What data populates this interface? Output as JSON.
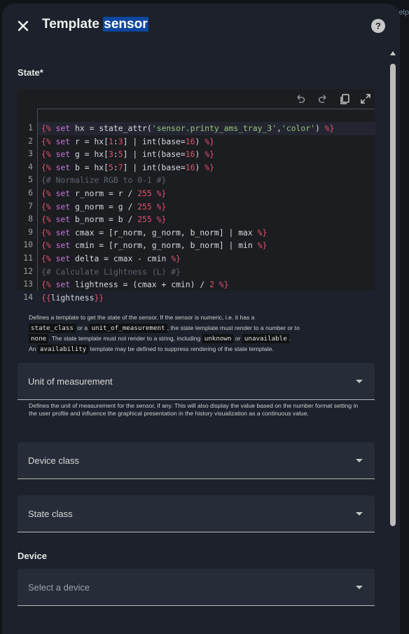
{
  "background": {
    "help_text": "elp"
  },
  "dialog": {
    "title_prefix": "Template ",
    "title_selected": "sensor"
  },
  "state": {
    "label": "State*",
    "editor": {
      "lines": [
        [
          [
            "tag",
            "{%"
          ],
          [
            "kw",
            " set "
          ],
          [
            "name",
            "hx"
          ],
          [
            "op",
            " = "
          ],
          [
            "name",
            "state_attr("
          ],
          [
            "str",
            "'sensor.printy_ams_tray_3'"
          ],
          [
            "op",
            ","
          ],
          [
            "str",
            "'color'"
          ],
          [
            "name",
            ")"
          ],
          [
            "tag",
            " %}"
          ]
        ],
        [
          [
            "tag",
            "{%"
          ],
          [
            "kw",
            " set "
          ],
          [
            "name",
            "r"
          ],
          [
            "op",
            " = "
          ],
          [
            "name",
            "hx["
          ],
          [
            "num",
            "1"
          ],
          [
            "op",
            ":"
          ],
          [
            "num",
            "3"
          ],
          [
            "name",
            "]"
          ],
          [
            "op",
            " | "
          ],
          [
            "name",
            "int(base="
          ],
          [
            "num",
            "16"
          ],
          [
            "name",
            ")"
          ],
          [
            "tag",
            " %}"
          ]
        ],
        [
          [
            "tag",
            "{%"
          ],
          [
            "kw",
            " set "
          ],
          [
            "name",
            "g"
          ],
          [
            "op",
            " = "
          ],
          [
            "name",
            "hx["
          ],
          [
            "num",
            "3"
          ],
          [
            "op",
            ":"
          ],
          [
            "num",
            "5"
          ],
          [
            "name",
            "]"
          ],
          [
            "op",
            " | "
          ],
          [
            "name",
            "int(base="
          ],
          [
            "num",
            "16"
          ],
          [
            "name",
            ")"
          ],
          [
            "tag",
            " %}"
          ]
        ],
        [
          [
            "tag",
            "{%"
          ],
          [
            "kw",
            " set "
          ],
          [
            "name",
            "b"
          ],
          [
            "op",
            " = "
          ],
          [
            "name",
            "hx["
          ],
          [
            "num",
            "5"
          ],
          [
            "op",
            ":"
          ],
          [
            "num",
            "7"
          ],
          [
            "name",
            "]"
          ],
          [
            "op",
            " | "
          ],
          [
            "name",
            "int(base="
          ],
          [
            "num",
            "16"
          ],
          [
            "name",
            ")"
          ],
          [
            "tag",
            " %}"
          ]
        ],
        [
          [
            "com",
            "{# Normalize RGB to 0-1 #}"
          ]
        ],
        [
          [
            "tag",
            "{%"
          ],
          [
            "kw",
            " set "
          ],
          [
            "name",
            "r_norm"
          ],
          [
            "op",
            " = "
          ],
          [
            "name",
            "r"
          ],
          [
            "op",
            " / "
          ],
          [
            "num",
            "255"
          ],
          [
            "tag",
            " %}"
          ]
        ],
        [
          [
            "tag",
            "{%"
          ],
          [
            "kw",
            " set "
          ],
          [
            "name",
            "g_norm"
          ],
          [
            "op",
            " = "
          ],
          [
            "name",
            "g"
          ],
          [
            "op",
            " / "
          ],
          [
            "num",
            "255"
          ],
          [
            "tag",
            " %}"
          ]
        ],
        [
          [
            "tag",
            "{%"
          ],
          [
            "kw",
            " set "
          ],
          [
            "name",
            "b_norm"
          ],
          [
            "op",
            " = "
          ],
          [
            "name",
            "b"
          ],
          [
            "op",
            " / "
          ],
          [
            "num",
            "255"
          ],
          [
            "tag",
            " %}"
          ]
        ],
        [
          [
            "tag",
            "{%"
          ],
          [
            "kw",
            " set "
          ],
          [
            "name",
            "cmax"
          ],
          [
            "op",
            " = "
          ],
          [
            "name",
            "[r_norm, g_norm, b_norm]"
          ],
          [
            "op",
            " | "
          ],
          [
            "name",
            "max"
          ],
          [
            "tag",
            " %}"
          ]
        ],
        [
          [
            "tag",
            "{%"
          ],
          [
            "kw",
            " set "
          ],
          [
            "name",
            "cmin"
          ],
          [
            "op",
            " = "
          ],
          [
            "name",
            "[r_norm, g_norm, b_norm]"
          ],
          [
            "op",
            " | "
          ],
          [
            "name",
            "min"
          ],
          [
            "tag",
            " %}"
          ]
        ],
        [
          [
            "tag",
            "{%"
          ],
          [
            "kw",
            " set "
          ],
          [
            "name",
            "delta"
          ],
          [
            "op",
            " = "
          ],
          [
            "name",
            "cmax"
          ],
          [
            "op",
            " - "
          ],
          [
            "name",
            "cmin"
          ],
          [
            "tag",
            " %}"
          ]
        ],
        [
          [
            "com",
            "{# Calculate Lightness (L) #}"
          ]
        ],
        [
          [
            "tag",
            "{%"
          ],
          [
            "kw",
            " set "
          ],
          [
            "name",
            "lightness"
          ],
          [
            "op",
            " = "
          ],
          [
            "name",
            "(cmax"
          ],
          [
            "op",
            " + "
          ],
          [
            "name",
            "cmin)"
          ],
          [
            "op",
            " / "
          ],
          [
            "num",
            "2"
          ],
          [
            "tag",
            " %}"
          ]
        ],
        [
          [
            "tag",
            "{{"
          ],
          [
            "name",
            "lightness"
          ],
          [
            "tag",
            "}}"
          ]
        ]
      ]
    },
    "helper": {
      "p1": "Defines a template to get the state of the sensor. If the sensor is numeric, i.e. it has a",
      "c1": "state_class",
      "p2": " or a ",
      "c2": "unit_of_measurement",
      "p3": ", the state template must render to a number or to",
      "c3": "none",
      "p4": ". The state template must not render to a string, including ",
      "c4": "unknown",
      "p5": " or ",
      "c5": "unavailable",
      "p6": ".",
      "p7": "An ",
      "c6": "availability",
      "p8": " template may be defined to suppress rendering of the state template."
    }
  },
  "unit_of_measurement": {
    "label": "Unit of measurement",
    "helper": "Defines the unit of measurement for the sensor, if any. This will also display the value based on the number format setting in the user profile and influence the graphical presentation in the history visualization as a continuous value."
  },
  "device_class": {
    "label": "Device class"
  },
  "state_class": {
    "label": "State class"
  },
  "device": {
    "label": "Device",
    "placeholder": "Select a device"
  },
  "icons": {
    "close": "close-icon",
    "help": "help-circle-icon",
    "undo": "undo-icon",
    "redo": "redo-icon",
    "copy": "copy-icon",
    "fullscreen": "fullscreen-icon",
    "dropdown": "chevron-down-icon"
  }
}
